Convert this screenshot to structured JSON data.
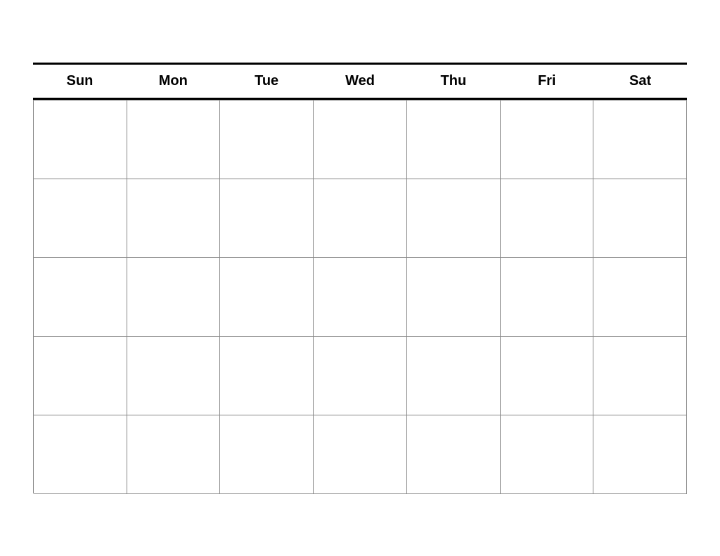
{
  "calendar": {
    "days": [
      {
        "label": "Sun",
        "key": "sun"
      },
      {
        "label": "Mon",
        "key": "mon"
      },
      {
        "label": "Tue",
        "key": "tue"
      },
      {
        "label": "Wed",
        "key": "wed"
      },
      {
        "label": "Thu",
        "key": "thu"
      },
      {
        "label": "Fri",
        "key": "fri"
      },
      {
        "label": "Sat",
        "key": "sat"
      }
    ],
    "rows": 5,
    "cols": 7
  }
}
